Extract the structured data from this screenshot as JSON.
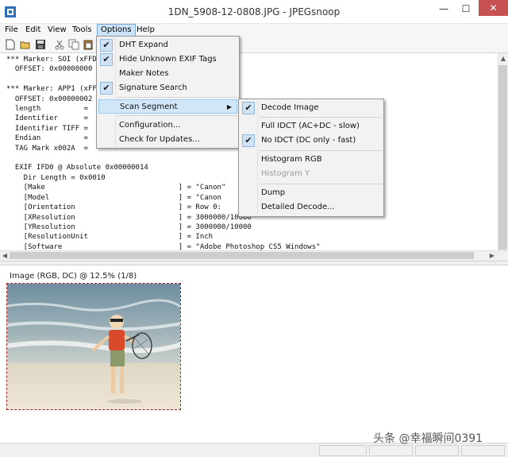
{
  "window": {
    "title": "1DN_5908-12-0808.JPG - JPEGsnoop",
    "min_glyph": "—",
    "max_glyph": "☐",
    "close_glyph": "✕"
  },
  "menubar": {
    "items": [
      "File",
      "Edit",
      "View",
      "Tools",
      "Options",
      "Help"
    ]
  },
  "log_lines": [
    "*** Marker: SOI (xFFD8) ***",
    "  OFFSET: 0x00000000",
    "",
    "*** Marker: APP1 (xFFE1) ***",
    "  OFFSET: 0x00000002",
    "  length          = ",
    "  Identifier      = ",
    "  Identifier TIFF = ",
    "  Endian          = ",
    "  TAG Mark x002A  = ",
    "",
    "  EXIF IFD0 @ Absolute 0x00000014",
    "    Dir Length = 0x0010",
    "    [Make                               ] = \"Canon\"",
    "    [Model                              ] = \"Canon",
    "    [Orientation                        ] = Row 0:",
    "    [XResolution                        ] = 3000000/10000",
    "    [YResolution                        ] = 3000000/10000",
    "    [ResolutionUnit                     ] = Inch",
    "    [Software                           ] = \"Adobe Photoshop CS5 Windows\""
  ],
  "options_menu": {
    "items": [
      {
        "label": "DHT Expand",
        "checked": true
      },
      {
        "label": "Hide Unknown EXIF Tags",
        "checked": true
      },
      {
        "label": "Maker Notes",
        "checked": false
      },
      {
        "label": "Signature Search",
        "checked": true
      },
      {
        "label": "Scan Segment",
        "submenu": true
      },
      {
        "label": "Configuration...",
        "checked": false
      },
      {
        "label": "Check for Updates...",
        "checked": false
      }
    ]
  },
  "scan_menu": {
    "items": [
      {
        "label": "Decode Image",
        "checked": true
      },
      {
        "label": "Full IDCT (AC+DC - slow)",
        "checked": false
      },
      {
        "label": "No IDCT (DC only - fast)",
        "checked": true
      },
      {
        "label": "Histogram RGB",
        "checked": false
      },
      {
        "label": "Histogram Y",
        "disabled": true
      },
      {
        "label": "Dump",
        "checked": false
      },
      {
        "label": "Detailed Decode...",
        "checked": false
      }
    ]
  },
  "image_pane": {
    "caption": "Image (RGB, DC) @ 12.5% (1/8)"
  },
  "watermark": "头条 @幸福瞬间0391",
  "check_glyph": "✔",
  "submenu_arrow": "▶"
}
